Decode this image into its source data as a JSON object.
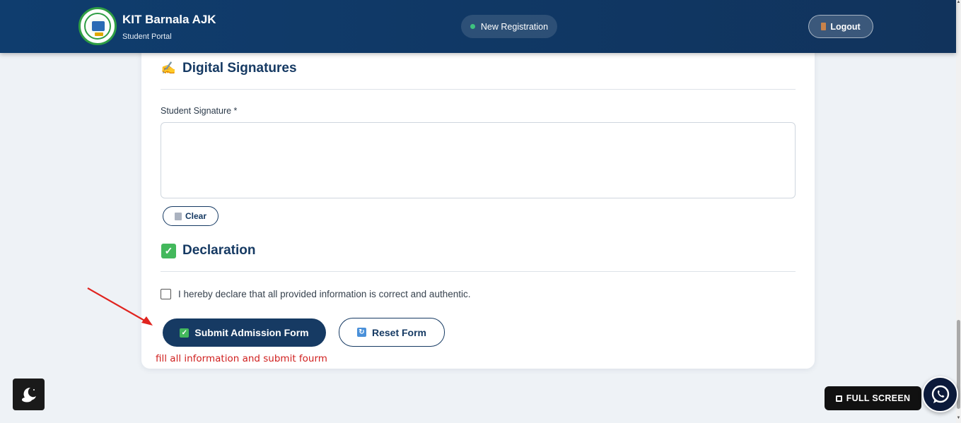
{
  "header": {
    "brand_title": "KIT Barnala AJK",
    "brand_subtitle": "Student Portal",
    "nav_label": "New Registration",
    "logout_label": "Logout"
  },
  "signatures": {
    "title": "Digital Signatures",
    "field_label": "Student Signature *",
    "clear_label": "Clear"
  },
  "declaration": {
    "title": "Declaration",
    "checkbox_text": "I hereby declare that all provided information is correct and authentic."
  },
  "actions": {
    "submit_label": "Submit Admission Form",
    "reset_label": "Reset Form"
  },
  "annotation": {
    "text": "fill all information and submit fourm",
    "color": "#d0201f"
  },
  "floating": {
    "fullscreen_label": "FULL SCREEN"
  },
  "colors": {
    "primary": "#163a63",
    "header_bg": "#0f3d6e",
    "success": "#43b85c"
  }
}
